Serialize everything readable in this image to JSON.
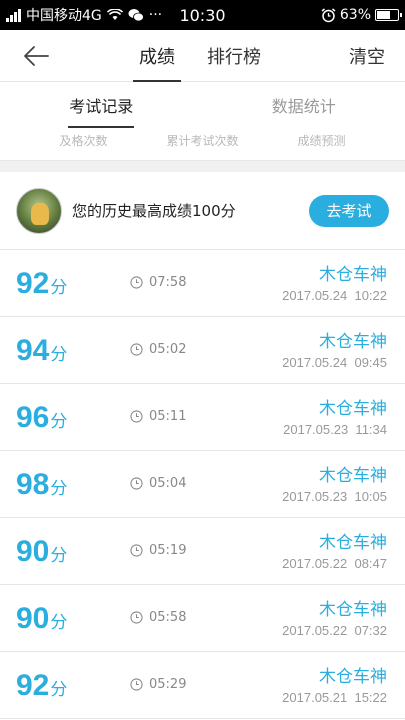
{
  "status_bar": {
    "carrier": "中国移动4G",
    "more": "···",
    "time": "10:30",
    "battery_text": "63%",
    "battery_level": 0.63
  },
  "header": {
    "tabs": [
      {
        "label": "成绩",
        "active": true
      },
      {
        "label": "排行榜",
        "active": false
      }
    ],
    "clear_label": "清空"
  },
  "sub_tabs": [
    {
      "label": "考试记录",
      "active": true
    },
    {
      "label": "数据统计",
      "active": false
    }
  ],
  "stats_labels": [
    "及格次数",
    "累计考试次数",
    "成绩预测"
  ],
  "best": {
    "text": "您的历史最高成绩100分",
    "button_label": "去考试"
  },
  "records": [
    {
      "score": "92",
      "unit": "分",
      "duration": "07:58",
      "name": "木仓车神",
      "datetime": "2017.05.24  10:22"
    },
    {
      "score": "94",
      "unit": "分",
      "duration": "05:02",
      "name": "木仓车神",
      "datetime": "2017.05.24  09:45"
    },
    {
      "score": "96",
      "unit": "分",
      "duration": "05:11",
      "name": "木仓车神",
      "datetime": "2017.05.23  11:34"
    },
    {
      "score": "98",
      "unit": "分",
      "duration": "05:04",
      "name": "木仓车神",
      "datetime": "2017.05.23  10:05"
    },
    {
      "score": "90",
      "unit": "分",
      "duration": "05:19",
      "name": "木仓车神",
      "datetime": "2017.05.22  08:47"
    },
    {
      "score": "90",
      "unit": "分",
      "duration": "05:58",
      "name": "木仓车神",
      "datetime": "2017.05.22  07:32"
    },
    {
      "score": "92",
      "unit": "分",
      "duration": "05:29",
      "name": "木仓车神",
      "datetime": "2017.05.21  15:22"
    }
  ],
  "colors": {
    "accent": "#2aaee0",
    "text": "#222222",
    "muted": "#999999"
  }
}
